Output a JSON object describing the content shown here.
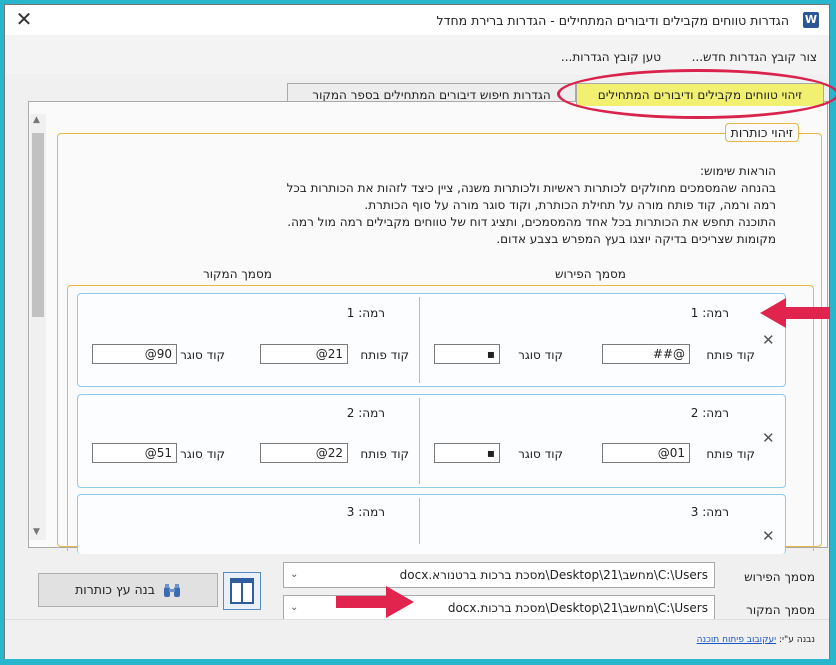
{
  "window": {
    "title": "הגדרות טווחים מקבילים ודיבורים המתחילים - הגדרות ברירת מחדל",
    "app_icon": "W",
    "close_glyph": "✕"
  },
  "menu": {
    "items": [
      {
        "label": "צור קובץ הגדרות חדש..."
      },
      {
        "label": "טען קובץ הגדרות..."
      }
    ]
  },
  "tabs": [
    {
      "label": "זיהוי טווחים מקבילים ודיבורים המתחילים",
      "active": true
    },
    {
      "label": "הגדרות חיפוש דיבורים המתחילים בספר המקור",
      "active": false
    }
  ],
  "group": {
    "legend": "זיהוי כותרות",
    "instructions": [
      "הוראות שימוש:",
      "בהנחה שהמסמכים מחולקים לכותרות ראשיות ולכותרות משנה, ציין כיצד לזהות את הכותרות בכל",
      "רמה ורמה, קוד פותח מורה על תחילת הכותרת, וקוד סוגר מורה על סוף הכותרת.",
      "התוכנה תחפש את הכותרות בכל אחד מהמסמכים, ותציג דוח של טווחים מקבילים רמה מול רמה.",
      "מקומות שצריכים בדיקה יוצגו בעץ המפרש בצבע אדום."
    ],
    "col_commentary": "מסמך הפירוש",
    "col_source": "מסמך המקור"
  },
  "field_labels": {
    "open_code": "קוד פותח",
    "close_code": "קוד סוגר",
    "remove_glyph": "✕"
  },
  "levels": [
    {
      "label": "רמה: 1",
      "commentary": {
        "open": "##@",
        "close": "▪"
      },
      "source": {
        "label": "רמה: 1",
        "open": "@21",
        "close": "@90"
      }
    },
    {
      "label": "רמה: 2",
      "commentary": {
        "open": "@01",
        "close": "▪"
      },
      "source": {
        "label": "רמה: 2",
        "open": "@22",
        "close": "@51"
      }
    },
    {
      "label": "רמה: 3",
      "commentary": {
        "open": "",
        "close": ""
      },
      "source": {
        "label": "רמה: 3",
        "open": "",
        "close": ""
      }
    }
  ],
  "footer": {
    "commentary_label": "מסמך הפירוש",
    "commentary_path": "C:\\Users\\מחשב\\21\\Desktop\\מסכת ברכות ברטנורא.docx",
    "source_label": "מסמך המקור",
    "source_path": "C:\\Users\\מחשב\\21\\Desktop\\מסכת ברכות.docx",
    "build_button": "בנה עץ כותרות",
    "combo_arrow": "⌄"
  },
  "credit": {
    "prefix": "נבנה ע\"י: ",
    "link": "יעקובוב פיתוח תוכנה"
  },
  "colors": {
    "accent_highlight": "#d9234c",
    "active_tab": "#f2f070",
    "frame": "#28b6cc"
  },
  "icons": [
    "word-app-icon",
    "close-icon",
    "binoculars-icon",
    "layout-columns-icon",
    "red-arrow-icon"
  ]
}
